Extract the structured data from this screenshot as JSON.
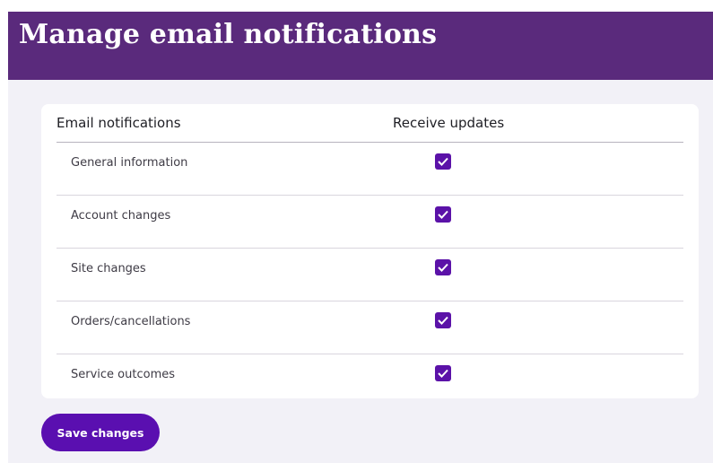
{
  "header": {
    "title": "Manage email notifications"
  },
  "table": {
    "columns": [
      "Email notifications",
      "Receive updates"
    ],
    "rows": [
      {
        "label": "General information",
        "checked": true
      },
      {
        "label": "Account changes",
        "checked": true
      },
      {
        "label": "Site changes",
        "checked": true
      },
      {
        "label": "Orders/cancellations",
        "checked": true
      },
      {
        "label": "Service outcomes",
        "checked": true
      }
    ]
  },
  "actions": {
    "save_label": "Save changes"
  },
  "colors": {
    "header_bg": "#5a2a7c",
    "accent": "#5b12a8",
    "page_bg": "#f2f1f7"
  },
  "icons": {
    "checkbox": "check-icon"
  }
}
